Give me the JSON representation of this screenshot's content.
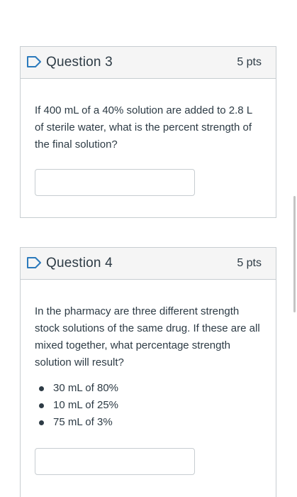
{
  "colors": {
    "flag_icon": "#2b7abc",
    "header_background": "#f5f5f5",
    "border": "#c7cdd1",
    "text": "#2d3b45"
  },
  "questions": [
    {
      "title": "Question 3",
      "points": "5 pts",
      "flag_icon": "bookmark-flag-icon",
      "prompt": "If 400 mL of a 40% solution are added to 2.8 L of sterile water, what is the percent strength of the final solution?",
      "answer_value": ""
    },
    {
      "title": "Question 4",
      "points": "5 pts",
      "flag_icon": "bookmark-flag-icon",
      "prompt": "In the pharmacy are three different strength stock solutions of the same drug. If these are all mixed together, what percentage strength solution will result?",
      "items": [
        "30 mL of 80%",
        "10 mL of 25%",
        "75 mL of 3%"
      ],
      "answer_value": ""
    }
  ]
}
